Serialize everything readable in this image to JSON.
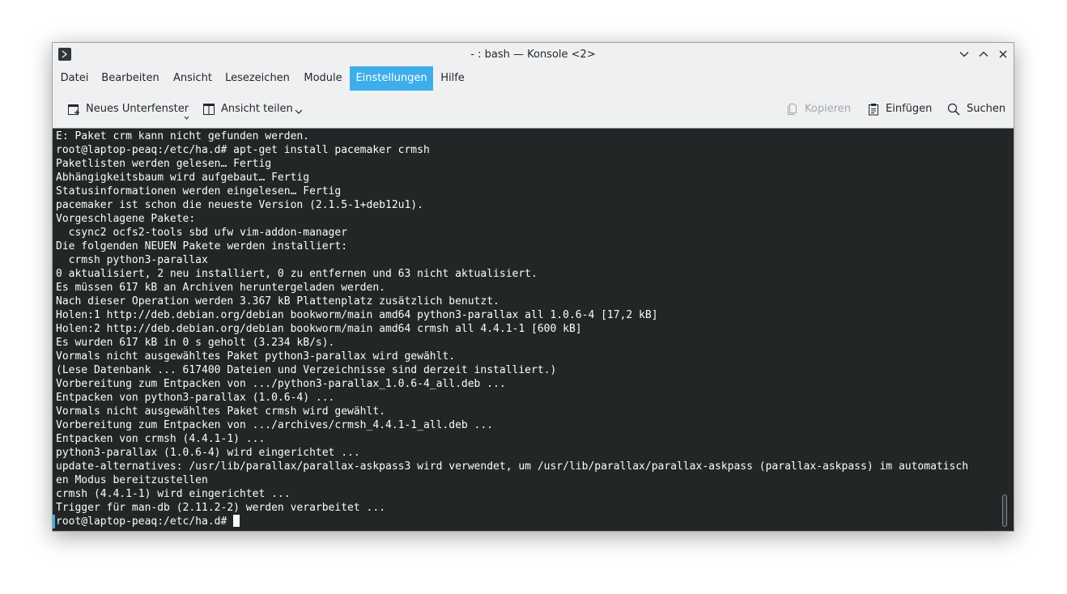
{
  "window": {
    "title": "- : bash — Konsole <2>"
  },
  "menu": [
    {
      "label": "Datei"
    },
    {
      "label": "Bearbeiten"
    },
    {
      "label": "Ansicht"
    },
    {
      "label": "Lesezeichen"
    },
    {
      "label": "Module"
    },
    {
      "label": "Einstellungen",
      "active": true
    },
    {
      "label": "Hilfe"
    }
  ],
  "toolbar": {
    "new_tab": {
      "label": "Neues Unterfenster",
      "icon": "new-tab-icon"
    },
    "split_view": {
      "label": "Ansicht teilen",
      "icon": "split-view-icon"
    },
    "copy": {
      "label": "Kopieren",
      "icon": "copy-icon",
      "disabled": true
    },
    "paste": {
      "label": "Einfügen",
      "icon": "paste-icon"
    },
    "find": {
      "label": "Suchen",
      "icon": "search-icon"
    }
  },
  "terminal": {
    "lines": [
      "E: Paket crm kann nicht gefunden werden.",
      "root@laptop-peaq:/etc/ha.d# apt-get install pacemaker crmsh",
      "Paketlisten werden gelesen… Fertig",
      "Abhängigkeitsbaum wird aufgebaut… Fertig",
      "Statusinformationen werden eingelesen… Fertig",
      "pacemaker ist schon die neueste Version (2.1.5-1+deb12u1).",
      "Vorgeschlagene Pakete:",
      "  csync2 ocfs2-tools sbd ufw vim-addon-manager",
      "Die folgenden NEUEN Pakete werden installiert:",
      "  crmsh python3-parallax",
      "0 aktualisiert, 2 neu installiert, 0 zu entfernen und 63 nicht aktualisiert.",
      "Es müssen 617 kB an Archiven heruntergeladen werden.",
      "Nach dieser Operation werden 3.367 kB Plattenplatz zusätzlich benutzt.",
      "Holen:1 http://deb.debian.org/debian bookworm/main amd64 python3-parallax all 1.0.6-4 [17,2 kB]",
      "Holen:2 http://deb.debian.org/debian bookworm/main amd64 crmsh all 4.4.1-1 [600 kB]",
      "Es wurden 617 kB in 0 s geholt (3.234 kB/s).",
      "Vormals nicht ausgewähltes Paket python3-parallax wird gewählt.",
      "(Lese Datenbank ... 617400 Dateien und Verzeichnisse sind derzeit installiert.)",
      "Vorbereitung zum Entpacken von .../python3-parallax_1.0.6-4_all.deb ...",
      "Entpacken von python3-parallax (1.0.6-4) ...",
      "Vormals nicht ausgewähltes Paket crmsh wird gewählt.",
      "Vorbereitung zum Entpacken von .../archives/crmsh_4.4.1-1_all.deb ...",
      "Entpacken von crmsh (4.4.1-1) ...",
      "python3-parallax (1.0.6-4) wird eingerichtet ...",
      "update-alternatives: /usr/lib/parallax/parallax-askpass3 wird verwendet, um /usr/lib/parallax/parallax-askpass (parallax-askpass) im automatisch",
      "en Modus bereitzustellen",
      "crmsh (4.4.1-1) wird eingerichtet ...",
      "Trigger für man-db (2.11.2-2) werden verarbeitet ...",
      "root@laptop-peaq:/etc/ha.d# "
    ]
  },
  "colors": {
    "accent": "#3daee9",
    "terminal_bg": "#232627",
    "terminal_fg": "#fcfcfc",
    "chrome_bg": "#eff0f1"
  }
}
